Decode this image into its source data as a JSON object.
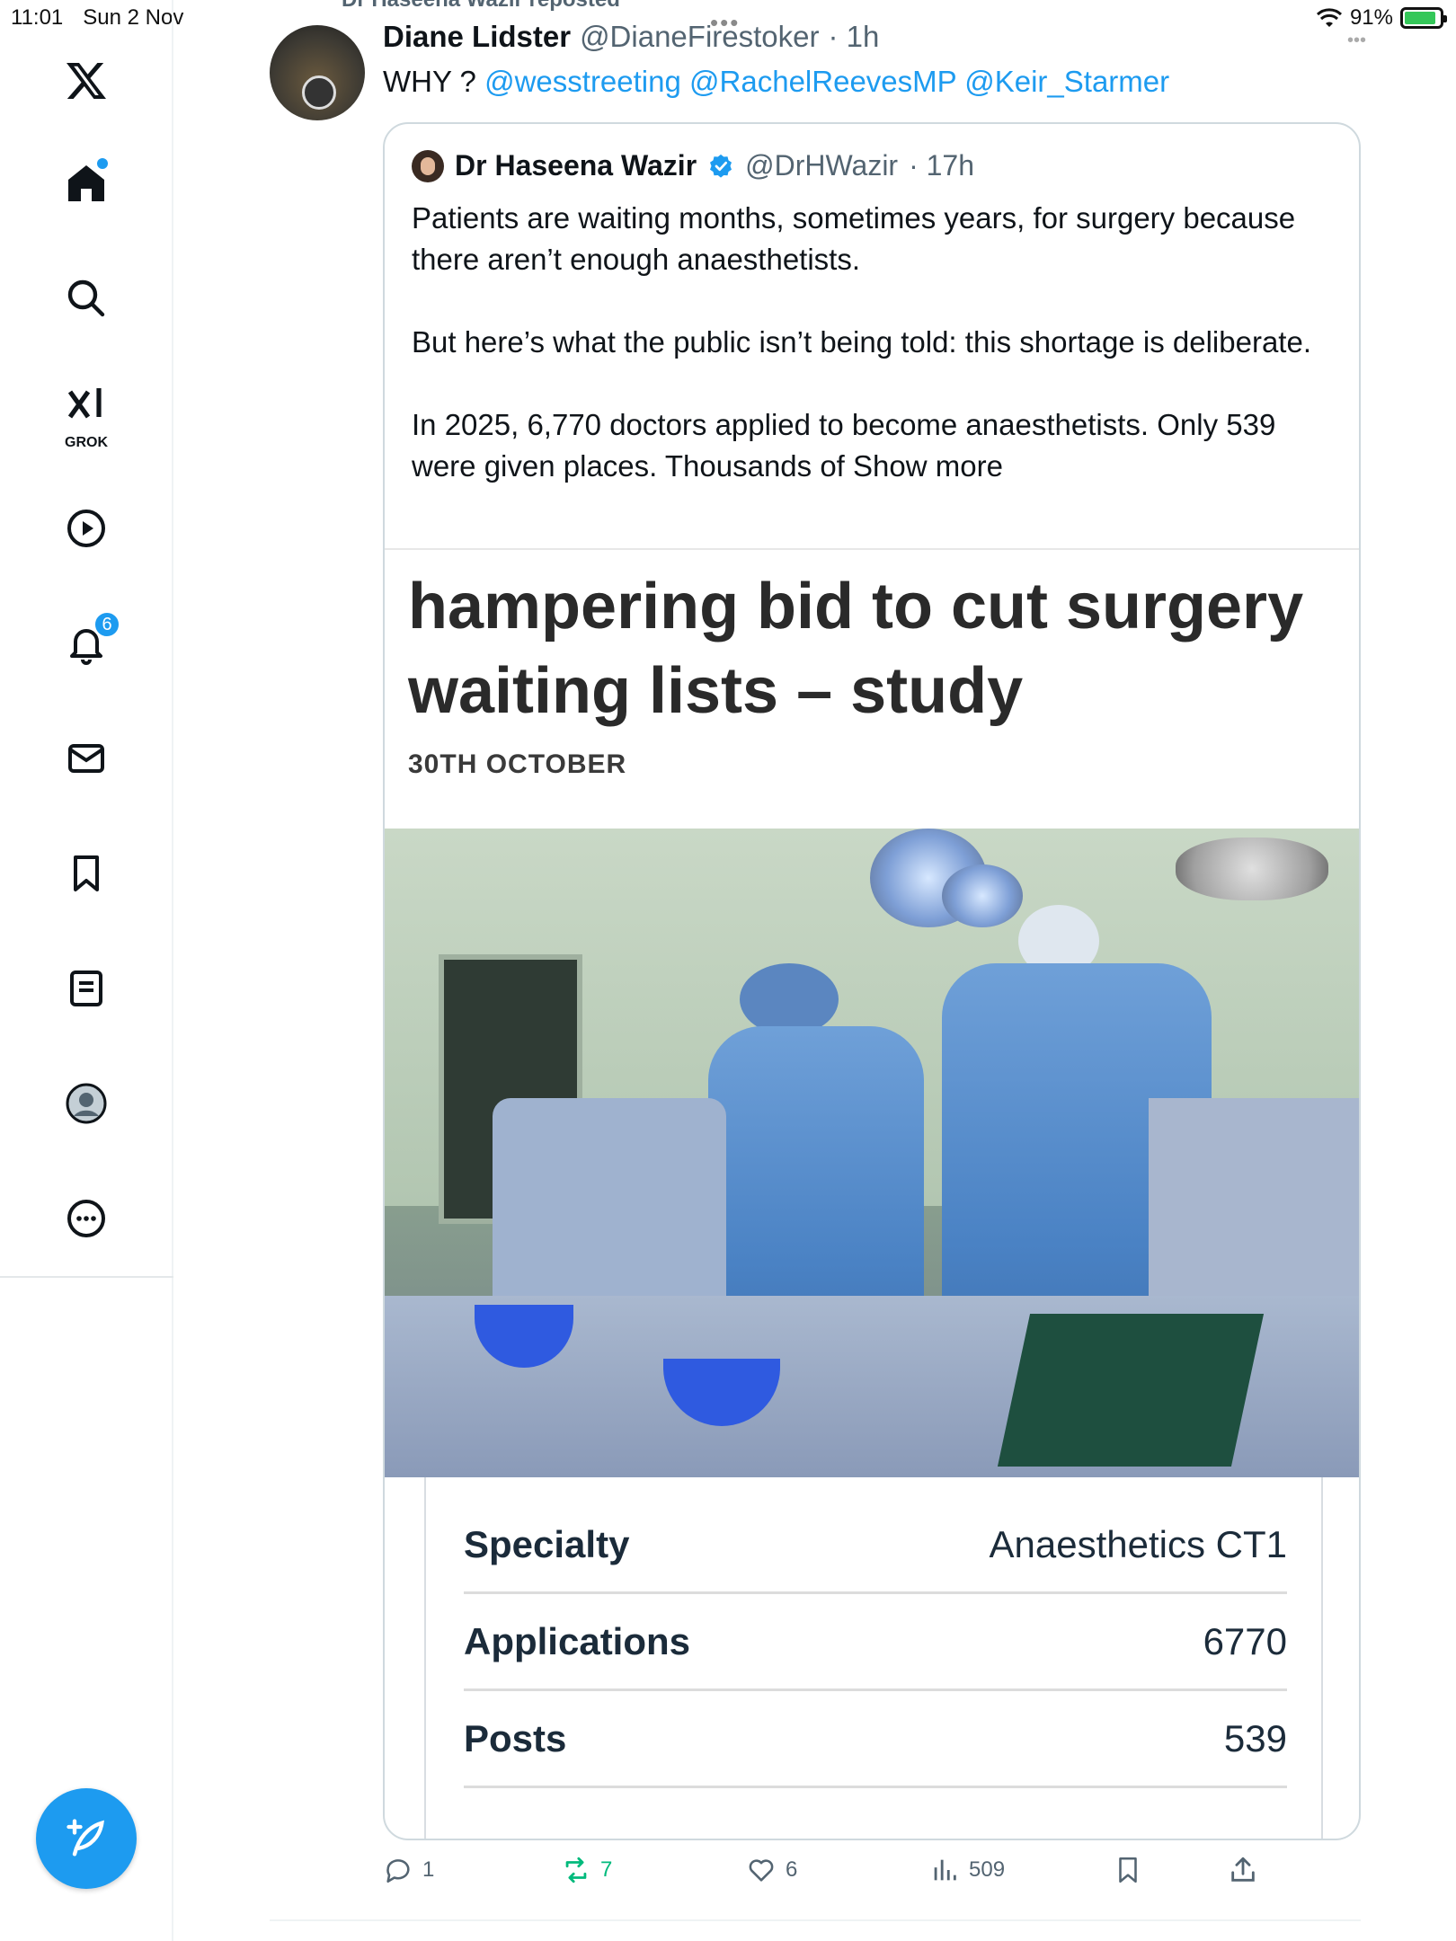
{
  "status_bar": {
    "time": "11:01",
    "date": "Sun 2 Nov",
    "battery": "91%"
  },
  "repost_header": "Dr Haseena Wazir reposted",
  "sidebar": {
    "notifications_badge": "6",
    "grok_label": "GROK"
  },
  "tweet": {
    "name": "Diane Lidster",
    "handle": "@DianeFirestoker",
    "time": "· 1h",
    "text_prefix": "WHY ? ",
    "mentions": [
      "@wesstreeting",
      "@RachelReevesMP",
      "@Keir_Starmer"
    ]
  },
  "quote": {
    "name": "Dr Haseena Wazir",
    "handle": "@DrHWazir",
    "time": "· 17h",
    "paragraphs": [
      "Patients are waiting months, sometimes years, for surgery because there aren’t enough anaesthetists.",
      "But here’s what the public isn’t being told: this shortage is deliberate.",
      "In 2025, 6,770 doctors applied to become anaesthetists. Only 539 were given places. Thousands of"
    ],
    "show_more": "Show more",
    "headline": "hampering bid to cut surgery waiting lists – study",
    "date": "30TH OCTOBER",
    "table": [
      {
        "key": "Specialty",
        "value": "Anaesthetics CT1"
      },
      {
        "key": "Applications",
        "value": "6770"
      },
      {
        "key": "Posts",
        "value": "539"
      }
    ]
  },
  "actions": {
    "replies": "1",
    "reposts": "7",
    "likes": "6",
    "views": "509"
  },
  "colors": {
    "accent": "#1d9bf0",
    "repost_green": "#00ba7c",
    "muted": "#536471"
  }
}
